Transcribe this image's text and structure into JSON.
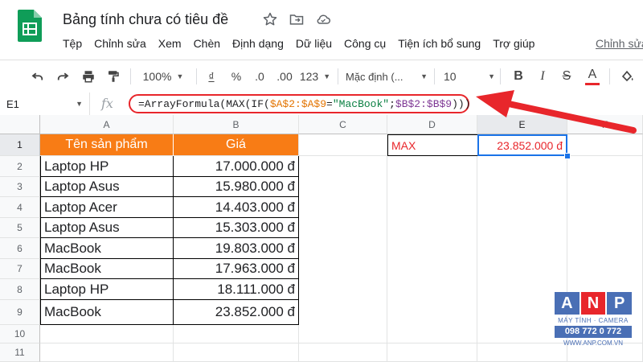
{
  "app": {
    "doc_title": "Bảng tính chưa có tiêu đề",
    "edit_link": "Chỉnh sửa",
    "menu": [
      "Tệp",
      "Chỉnh sửa",
      "Xem",
      "Chèn",
      "Định dạng",
      "Dữ liệu",
      "Công cụ",
      "Tiện ích bổ sung",
      "Trợ giúp"
    ]
  },
  "toolbar": {
    "zoom": "100%",
    "currency": "₫",
    "percent": "%",
    "decimal_decrease": ".0",
    "decimal_increase": ".00",
    "number_format": "123",
    "font": "Mặc định (...",
    "font_size": "10",
    "bold": "B",
    "italic": "I",
    "strike": "S",
    "text_color": "A"
  },
  "formula_bar": {
    "name_box": "E1",
    "fx": "fx",
    "formula_parts": [
      "=ArrayFormula(MAX(IF(",
      "$A$2:$A$9",
      "=",
      "\"MacBook\"",
      ";",
      "$B$2:$B$9",
      ")))"
    ]
  },
  "sheet": {
    "columns": [
      "A",
      "B",
      "C",
      "D",
      "E",
      "F"
    ],
    "active_column": "E",
    "rows": [
      "1",
      "2",
      "3",
      "4",
      "5",
      "6",
      "7",
      "8",
      "9",
      "10",
      "11"
    ],
    "active_row": "1",
    "header": {
      "a": "Tên sản phẩm",
      "b": "Giá"
    },
    "data": [
      {
        "product": "Laptop HP",
        "price": "17.000.000 đ"
      },
      {
        "product": "Laptop Asus",
        "price": "15.980.000 đ"
      },
      {
        "product": "Laptop Acer",
        "price": "14.403.000 đ"
      },
      {
        "product": "Laptop Asus",
        "price": "15.303.000 đ"
      },
      {
        "product": "MacBook",
        "price": "19.803.000 đ"
      },
      {
        "product": "MacBook",
        "price": "17.963.000 đ"
      },
      {
        "product": "Laptop HP",
        "price": "18.111.000 đ"
      },
      {
        "product": "MacBook",
        "price": "23.852.000 đ"
      }
    ],
    "d1": "MAX",
    "e1": "23.852.000 đ"
  },
  "colors": {
    "header_fill": "#f87c15",
    "accent_red": "#e8262b",
    "selection_blue": "#1a73e8"
  },
  "watermark": {
    "letters": [
      "A",
      "N",
      "P"
    ],
    "line1": "MÁY TÍNH · CAMERA",
    "phone": "098 772 0 772",
    "site": "WWW.ANP.COM.VN"
  }
}
